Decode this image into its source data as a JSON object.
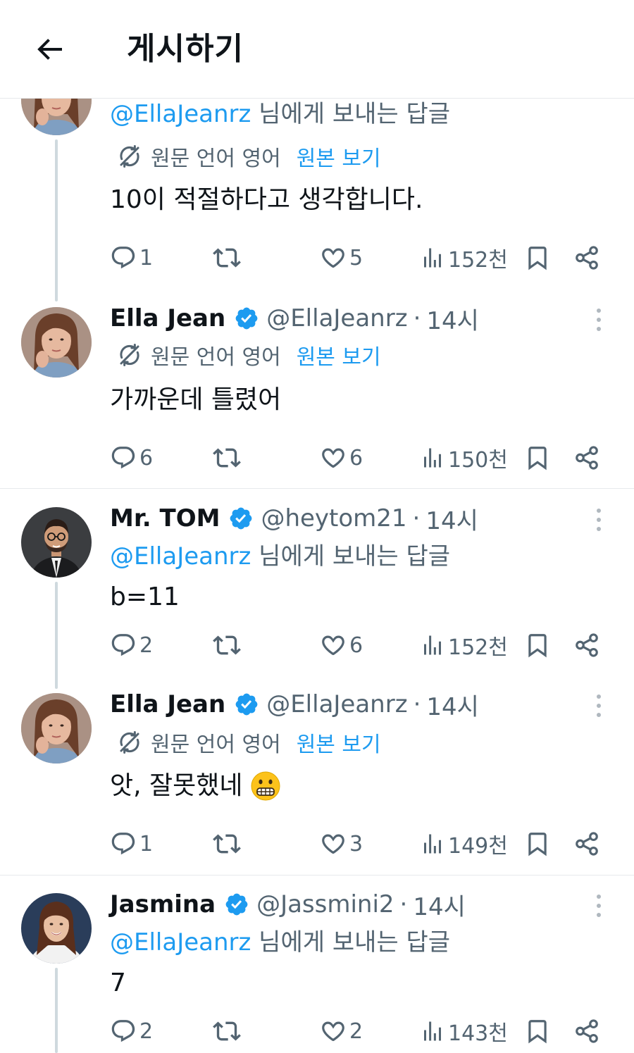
{
  "header": {
    "title": "게시하기"
  },
  "labels": {
    "reply_suffix": " 님에게 보내는 답글",
    "original_language": "원문 언어 영어",
    "show_original": "원본 보기"
  },
  "colors": {
    "accent": "#1d9bf0",
    "text": "#0f1419",
    "secondary": "#536471",
    "border": "#e6e9ec"
  },
  "tweets": [
    {
      "partial": true,
      "reply_to": "@EllaJeanrz",
      "text": "10이 적절하다고 생각합니다.",
      "replies": "1",
      "likes": "5",
      "views": "152천"
    },
    {
      "name": "Ella Jean",
      "handle": "@EllaJeanrz",
      "time": "14시",
      "text": "가까운데 틀렸어",
      "replies": "6",
      "likes": "6",
      "views": "150천"
    },
    {
      "name": "Mr. TOM",
      "handle": "@heytom21",
      "time": "14시",
      "reply_to": "@EllaJeanrz",
      "text": "b=11",
      "replies": "2",
      "likes": "6",
      "views": "152천"
    },
    {
      "name": "Ella Jean",
      "handle": "@EllaJeanrz",
      "time": "14시",
      "text": "앗, 잘못했네",
      "emoji": "grimacing-face",
      "replies": "1",
      "likes": "3",
      "views": "149천"
    },
    {
      "name": "Jasmina",
      "handle": "@Jassmini2",
      "time": "14시",
      "reply_to": "@EllaJeanrz",
      "text": "7",
      "replies": "2",
      "likes": "2",
      "views": "143천"
    }
  ]
}
